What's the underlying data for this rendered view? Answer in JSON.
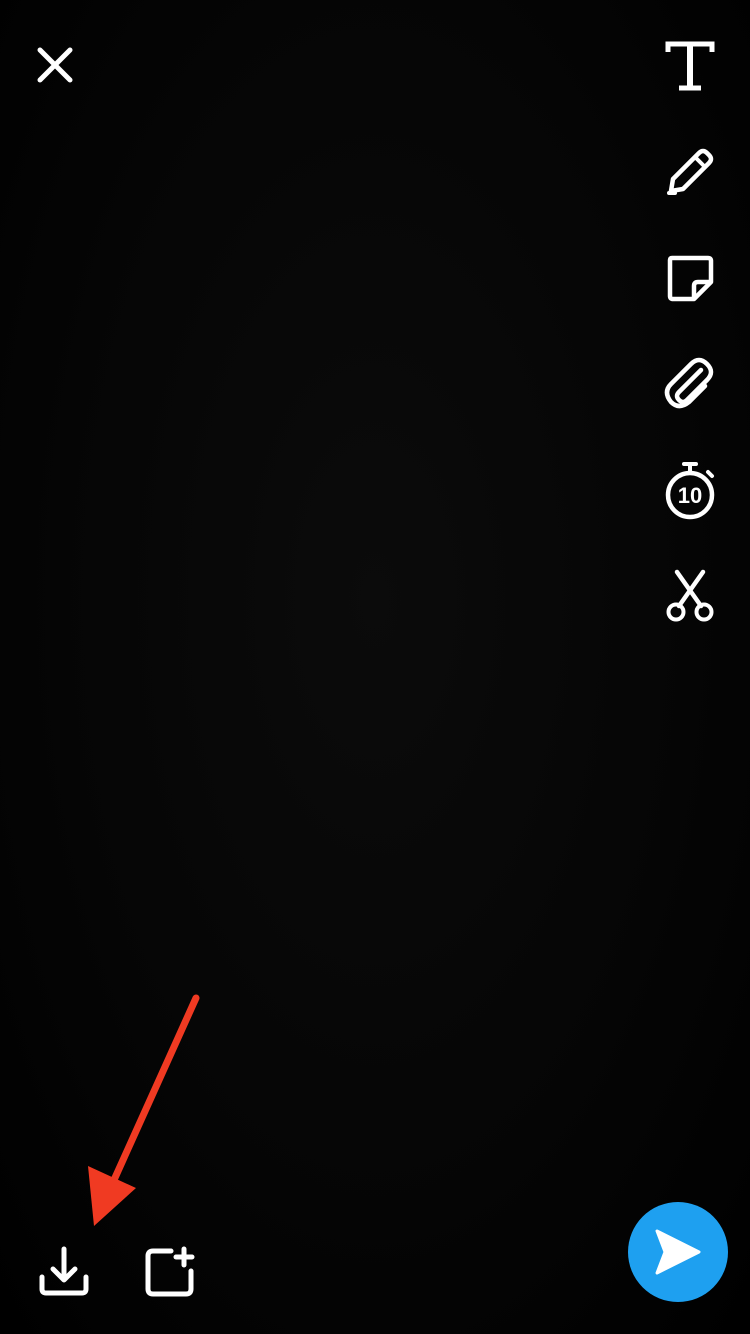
{
  "colors": {
    "background": "#000000",
    "icon": "#ffffff",
    "send_button": "#1ea0f0",
    "annotation_arrow": "#f03a22"
  },
  "top_bar": {
    "close_icon": "close-icon"
  },
  "toolbar": {
    "items": [
      {
        "icon": "text-icon"
      },
      {
        "icon": "pencil-icon"
      },
      {
        "icon": "sticker-icon"
      },
      {
        "icon": "paperclip-icon"
      },
      {
        "icon": "timer-icon",
        "value": "10"
      },
      {
        "icon": "scissors-icon"
      }
    ]
  },
  "bottom_bar": {
    "save_icon": "download-icon",
    "story_icon": "add-to-story-icon",
    "send_icon": "send-arrow-icon"
  }
}
